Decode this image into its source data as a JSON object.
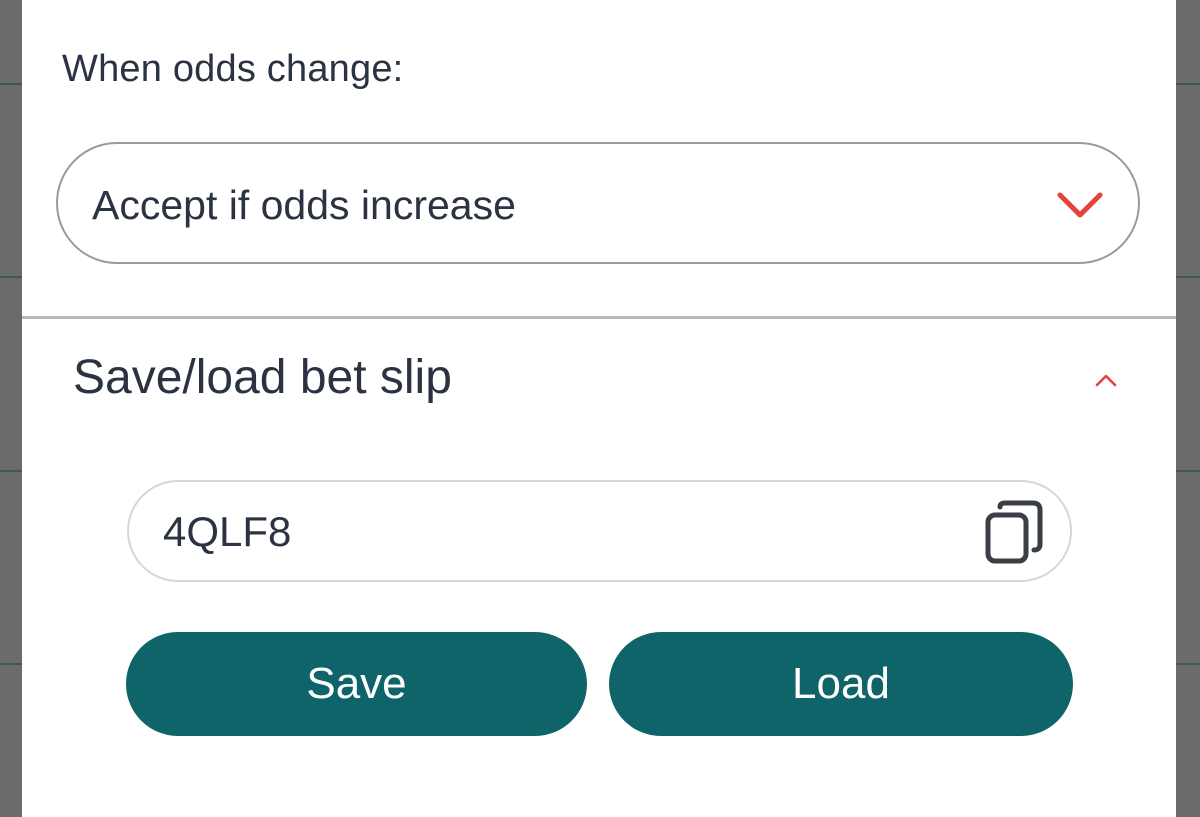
{
  "odds": {
    "label": "When odds change:",
    "selected": "Accept if odds increase",
    "chevron_icon": "chevron-down-icon",
    "accent_color": "#e2453c"
  },
  "bet_slip": {
    "title": "Save/load bet slip",
    "toggle_icon": "chevron-up-icon",
    "code": "4QLF8",
    "copy_icon": "copy-icon",
    "save_label": "Save",
    "load_label": "Load",
    "button_color": "#0e6469"
  }
}
